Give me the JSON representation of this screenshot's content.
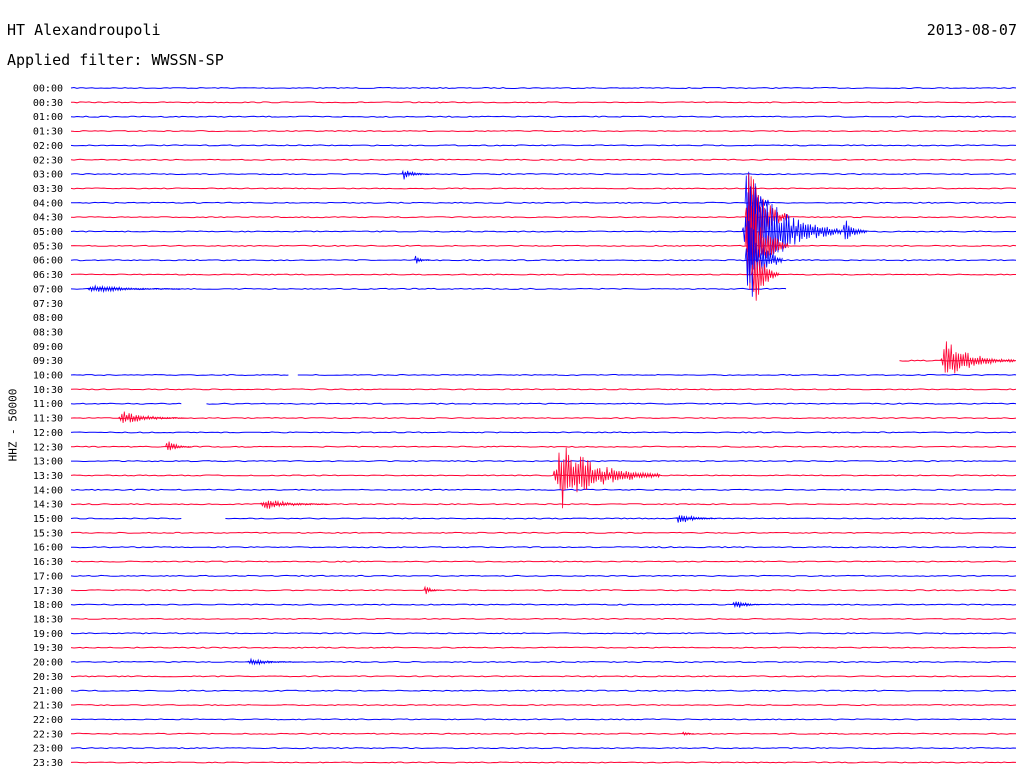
{
  "header": {
    "station": "HT Alexandroupoli",
    "date": "2013-08-07",
    "filter": "Applied filter: WWSSN-SP",
    "channel": "HHZ - 50000"
  },
  "colors": {
    "blue": "#0000ff",
    "red": "#ff0033",
    "text": "#000000",
    "background": "#ffffff"
  },
  "chart_data": {
    "type": "line",
    "title": "HT Alexandroupoli",
    "subtitle": "Applied filter: WWSSN-SP",
    "ylabel": "HHZ - 50000",
    "xlabel": "",
    "grid": false,
    "rows": [
      "00:00",
      "00:30",
      "01:00",
      "01:30",
      "02:00",
      "02:30",
      "03:00",
      "03:30",
      "04:00",
      "04:30",
      "05:00",
      "05:30",
      "06:00",
      "06:30",
      "07:00",
      "07:30",
      "08:00",
      "08:30",
      "09:00",
      "09:30",
      "10:00",
      "10:30",
      "11:00",
      "11:30",
      "12:00",
      "12:30",
      "13:00",
      "13:30",
      "14:00",
      "14:30",
      "15:00",
      "15:30",
      "16:00",
      "16:30",
      "17:00",
      "17:30",
      "18:00",
      "18:30",
      "19:00",
      "19:30",
      "20:00",
      "20:30",
      "21:00",
      "21:30",
      "22:00",
      "22:30",
      "23:00",
      "23:30"
    ],
    "row_minutes": 30,
    "series_colors": [
      "#0000ff",
      "#ff0033"
    ],
    "trace_coverage": [
      [
        0,
        30
      ],
      [
        0,
        30
      ],
      [
        0,
        30
      ],
      [
        0,
        30
      ],
      [
        0,
        30
      ],
      [
        0,
        30
      ],
      [
        0,
        30
      ],
      [
        0,
        30
      ],
      [
        0,
        30
      ],
      [
        0,
        30
      ],
      [
        0,
        30
      ],
      [
        0,
        30
      ],
      [
        0,
        30
      ],
      [
        0,
        30
      ],
      [
        0,
        22.7
      ],
      null,
      null,
      null,
      null,
      [
        26.3,
        30
      ],
      [
        0,
        30
      ],
      [
        0,
        30
      ],
      [
        0,
        30
      ],
      [
        0,
        30
      ],
      [
        0,
        30
      ],
      [
        0,
        30
      ],
      [
        0,
        30
      ],
      [
        0,
        30
      ],
      [
        0,
        30
      ],
      [
        0,
        30
      ],
      [
        0,
        30
      ],
      [
        0,
        30
      ],
      [
        0,
        30
      ],
      [
        0,
        30
      ],
      [
        0,
        30
      ],
      [
        0,
        30
      ],
      [
        0,
        30
      ],
      [
        0,
        30
      ],
      [
        0,
        30
      ],
      [
        0,
        30
      ],
      [
        0,
        30
      ],
      [
        0,
        30
      ],
      [
        0,
        30
      ],
      [
        0,
        30
      ],
      [
        0,
        30
      ],
      [
        0,
        30
      ],
      [
        0,
        30
      ],
      [
        0,
        30
      ]
    ],
    "gaps": [
      {
        "row": "10:00",
        "start_min": 6.9,
        "end_min": 7.2
      },
      {
        "row": "11:00",
        "start_min": 3.5,
        "end_min": 4.3
      },
      {
        "row": "15:00",
        "start_min": 3.5,
        "end_min": 4.9
      }
    ],
    "events": [
      {
        "row": "04:00",
        "start_min": 21.4,
        "end_min": 22.2,
        "amplitude": 0.8
      },
      {
        "row": "04:30",
        "start_min": 21.4,
        "end_min": 22.8,
        "amplitude": 1.0
      },
      {
        "row": "05:00",
        "start_min": 21.3,
        "end_min": 24.5,
        "amplitude": 1.0
      },
      {
        "row": "05:00",
        "start_min": 24.5,
        "end_min": 25.3,
        "amplitude": 0.3
      },
      {
        "row": "05:30",
        "start_min": 21.4,
        "end_min": 22.8,
        "amplitude": 1.0
      },
      {
        "row": "06:00",
        "start_min": 21.4,
        "end_min": 22.6,
        "amplitude": 0.9
      },
      {
        "row": "06:30",
        "start_min": 21.6,
        "end_min": 22.5,
        "amplitude": 0.7
      },
      {
        "row": "09:30",
        "start_min": 27.6,
        "end_min": 30.0,
        "amplitude": 0.35
      },
      {
        "row": "13:30",
        "start_min": 15.3,
        "end_min": 18.7,
        "amplitude": 0.6
      },
      {
        "row": "11:30",
        "start_min": 1.5,
        "end_min": 3.6,
        "amplitude": 0.12
      },
      {
        "row": "12:30",
        "start_min": 3.0,
        "end_min": 3.8,
        "amplitude": 0.12
      },
      {
        "row": "14:30",
        "start_min": 6.0,
        "end_min": 8.2,
        "amplitude": 0.1
      },
      {
        "row": "15:00",
        "start_min": 19.2,
        "end_min": 20.5,
        "amplitude": 0.1
      },
      {
        "row": "18:00",
        "start_min": 21.0,
        "end_min": 21.9,
        "amplitude": 0.1
      },
      {
        "row": "03:00",
        "start_min": 10.5,
        "end_min": 11.4,
        "amplitude": 0.1
      },
      {
        "row": "06:00",
        "start_min": 10.9,
        "end_min": 11.4,
        "amplitude": 0.08
      },
      {
        "row": "20:00",
        "start_min": 5.6,
        "end_min": 7.3,
        "amplitude": 0.06
      },
      {
        "row": "17:30",
        "start_min": 11.2,
        "end_min": 11.8,
        "amplitude": 0.08
      },
      {
        "row": "22:30",
        "start_min": 19.4,
        "end_min": 19.8,
        "amplitude": 0.06
      },
      {
        "row": "07:00",
        "start_min": 0.5,
        "end_min": 3.5,
        "amplitude": 0.07
      }
    ]
  }
}
